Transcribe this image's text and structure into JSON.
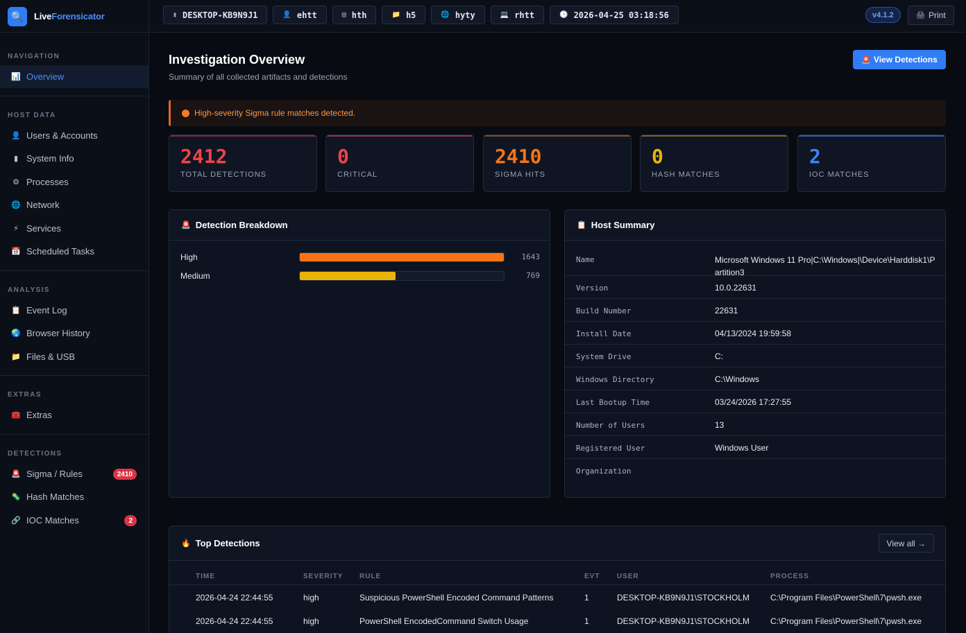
{
  "brand": {
    "prefix": "Live",
    "accent": "Forensicator"
  },
  "chips": [
    {
      "icon": "computer-icon",
      "glyph": "▮",
      "label": "DESKTOP-KB9N9J1"
    },
    {
      "icon": "user-icon",
      "glyph": "👤",
      "label": "ehtt"
    },
    {
      "icon": "clipboard-icon",
      "glyph": "▤",
      "label": "hth"
    },
    {
      "icon": "folder-icon",
      "glyph": "📁",
      "label": "h5"
    },
    {
      "icon": "globe-icon",
      "glyph": "🌐",
      "label": "hyty"
    },
    {
      "icon": "laptop-icon",
      "glyph": "💻",
      "label": "rhtt"
    },
    {
      "icon": "clock-icon",
      "glyph": "🕓",
      "label": "2026-04-25 03:18:56"
    }
  ],
  "version": "v4.1.2",
  "print_label": "Print",
  "sidebar": {
    "sections": [
      {
        "title": "NAVIGATION",
        "items": [
          {
            "label": "Overview",
            "icon": "chart-icon",
            "glyph": "📊",
            "active": true
          }
        ]
      },
      {
        "title": "HOST DATA",
        "items": [
          {
            "label": "Users & Accounts",
            "icon": "user-icon",
            "glyph": "👤"
          },
          {
            "label": "System Info",
            "icon": "computer-icon",
            "glyph": "▮"
          },
          {
            "label": "Processes",
            "icon": "gear-icon",
            "glyph": "⚙"
          },
          {
            "label": "Network",
            "icon": "globe-icon",
            "glyph": "🌐"
          },
          {
            "label": "Services",
            "icon": "lightning-icon",
            "glyph": "⚡"
          },
          {
            "label": "Scheduled Tasks",
            "icon": "calendar-icon",
            "glyph": "📅"
          }
        ]
      },
      {
        "title": "ANALYSIS",
        "items": [
          {
            "label": "Event Log",
            "icon": "clipboard-icon",
            "glyph": "📋"
          },
          {
            "label": "Browser History",
            "icon": "earth-icon",
            "glyph": "🌏"
          },
          {
            "label": "Files & USB",
            "icon": "folder-icon",
            "glyph": "📁"
          }
        ]
      },
      {
        "title": "EXTRAS",
        "items": [
          {
            "label": "Extras",
            "icon": "toolbox-icon",
            "glyph": "🧰"
          }
        ]
      },
      {
        "title": "DETECTIONS",
        "items": [
          {
            "label": "Sigma / Rules",
            "icon": "siren-icon",
            "glyph": "🚨",
            "badge": "2410"
          },
          {
            "label": "Hash Matches",
            "icon": "bug-icon",
            "glyph": "🦠"
          },
          {
            "label": "IOC Matches",
            "icon": "link-icon",
            "glyph": "🔗",
            "badge": "2"
          }
        ]
      }
    ]
  },
  "main": {
    "title": "Investigation Overview",
    "subtitle": "Summary of all collected artifacts and detections",
    "view_detections": "View Detections",
    "alert": "High-severity Sigma rule matches detected."
  },
  "stats": [
    {
      "value": "2412",
      "label": "TOTAL DETECTIONS",
      "color": "#ef4444",
      "bar": "#7a2f3a"
    },
    {
      "value": "0",
      "label": "CRITICAL",
      "color": "#ef4444",
      "bar": "#8a3440"
    },
    {
      "value": "2410",
      "label": "SIGMA HITS",
      "color": "#f97316",
      "bar": "#8a4a22"
    },
    {
      "value": "0",
      "label": "HASH MATCHES",
      "color": "#eab308",
      "bar": "#7a6520"
    },
    {
      "value": "2",
      "label": "IOC MATCHES",
      "color": "#3b82f6",
      "bar": "#2d5fb3"
    }
  ],
  "breakdown": {
    "title": "Detection Breakdown",
    "rows": [
      {
        "label": "High",
        "count": "1643",
        "fraction": 1.0,
        "color": "#f97316"
      },
      {
        "label": "Medium",
        "count": "769",
        "fraction": 0.468,
        "color": "#eab308"
      }
    ]
  },
  "host": {
    "title": "Host Summary",
    "rows": [
      {
        "key": "Name",
        "value": "Microsoft Windows 11 Pro|C:\\Windows|\\Device\\Harddisk1\\Partition3"
      },
      {
        "key": "Version",
        "value": "10.0.22631"
      },
      {
        "key": "Build Number",
        "value": "22631"
      },
      {
        "key": "Install Date",
        "value": "04/13/2024 19:59:58"
      },
      {
        "key": "System Drive",
        "value": "C:"
      },
      {
        "key": "Windows Directory",
        "value": "C:\\Windows"
      },
      {
        "key": "Last Bootup Time",
        "value": "03/24/2026 17:27:55"
      },
      {
        "key": "Number of Users",
        "value": "13"
      },
      {
        "key": "Registered User",
        "value": "Windows User"
      },
      {
        "key": "Organization",
        "value": ""
      }
    ]
  },
  "top": {
    "title": "Top Detections",
    "view_all": "View all →",
    "columns": [
      "TIME",
      "SEVERITY",
      "RULE",
      "EVT",
      "USER",
      "PROCESS"
    ],
    "rows": [
      [
        "2026-04-24 22:44:55",
        "high",
        "Suspicious PowerShell Encoded Command Patterns",
        "1",
        "DESKTOP-KB9N9J1\\STOCKHOLM",
        "C:\\Program Files\\PowerShell\\7\\pwsh.exe"
      ],
      [
        "2026-04-24 22:44:55",
        "high",
        "PowerShell EncodedCommand Switch Usage",
        "1",
        "DESKTOP-KB9N9J1\\STOCKHOLM",
        "C:\\Program Files\\PowerShell\\7\\pwsh.exe"
      ]
    ]
  }
}
